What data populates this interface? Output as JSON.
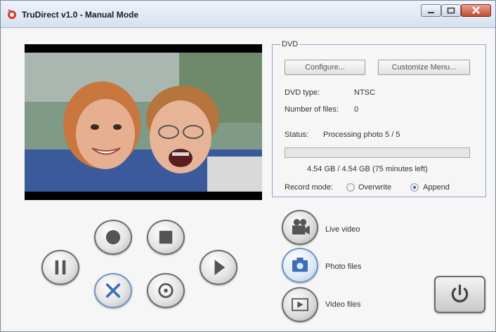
{
  "window": {
    "title": "TruDirect v1.0 - Manual Mode"
  },
  "dvd": {
    "legend": "DVD",
    "configure_label": "Configure...",
    "customize_label": "Customize Menu...",
    "type_label": "DVD type:",
    "type_value": "NTSC",
    "files_label": "Number of files:",
    "files_value": "0",
    "status_label": "Status:",
    "status_value": "Processing photo 5 / 5",
    "progress_fraction": 0.0,
    "space_text": "4.54 GB / 4.54 GB (75 minutes left)",
    "record_mode_label": "Record mode:",
    "overwrite_label": "Overwrite",
    "append_label": "Append",
    "record_mode_selected": "Append"
  },
  "sources": {
    "live_video_label": "Live video",
    "photo_files_label": "Photo files",
    "video_files_label": "Video files",
    "active": "Photo files"
  },
  "colors": {
    "accent": "#6f95c8",
    "panel_border": "#8fa7c8"
  }
}
